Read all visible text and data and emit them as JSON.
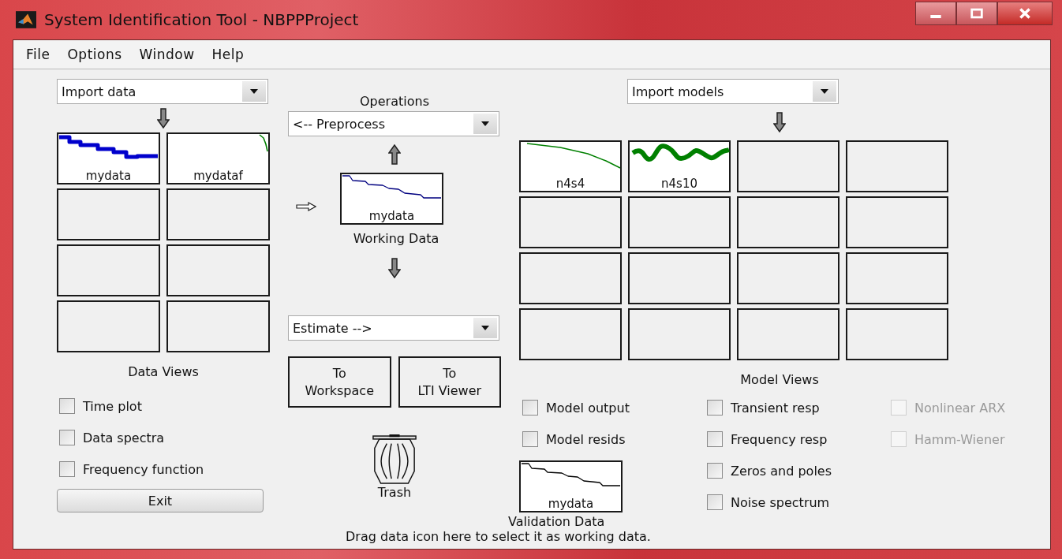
{
  "window": {
    "title": "System Identification Tool - NBPPProject"
  },
  "menu": [
    "File",
    "Options",
    "Window",
    "Help"
  ],
  "data_board": {
    "import": "Import data",
    "title": "Data Views",
    "tiles": [
      {
        "kind": "plot",
        "label": "mydata",
        "trace": {
          "kind": "step-thick",
          "color": "#0000cc"
        }
      },
      {
        "kind": "plot",
        "label": "mydataf",
        "trace": {
          "kind": "corner",
          "color": "#008000"
        }
      },
      {
        "kind": "empty"
      },
      {
        "kind": "empty"
      },
      {
        "kind": "empty"
      },
      {
        "kind": "empty"
      },
      {
        "kind": "empty"
      },
      {
        "kind": "empty"
      }
    ]
  },
  "data_views": [
    {
      "label": "Time plot",
      "checked": false
    },
    {
      "label": "Data spectra",
      "checked": false
    },
    {
      "label": "Frequency function",
      "checked": false
    }
  ],
  "exit_button": "Exit",
  "operations": {
    "title": "Operations",
    "preprocess": "<-- Preprocess",
    "working_data": {
      "label": "mydata",
      "caption": "Working Data",
      "trace": {
        "kind": "step",
        "color": "#000080"
      }
    },
    "estimate": "Estimate -->"
  },
  "export_buttons": [
    "To\nWorkspace",
    "To\nLTI Viewer"
  ],
  "trash": "Trash",
  "model_board": {
    "import": "Import models",
    "title": "Model Views",
    "tiles": [
      {
        "kind": "plot",
        "label": "n4s4",
        "trace": {
          "kind": "decay",
          "color": "#008000"
        }
      },
      {
        "kind": "plot",
        "label": "n4s10",
        "trace": {
          "kind": "wave-thick",
          "color": "#008000"
        }
      },
      {
        "kind": "empty"
      },
      {
        "kind": "empty"
      },
      {
        "kind": "empty"
      },
      {
        "kind": "empty"
      },
      {
        "kind": "empty"
      },
      {
        "kind": "empty"
      },
      {
        "kind": "empty"
      },
      {
        "kind": "empty"
      },
      {
        "kind": "empty"
      },
      {
        "kind": "empty"
      },
      {
        "kind": "empty"
      },
      {
        "kind": "empty"
      },
      {
        "kind": "empty"
      },
      {
        "kind": "empty"
      }
    ]
  },
  "model_views": [
    [
      {
        "label": "Model output",
        "checked": false,
        "disabled": false
      },
      {
        "label": "Model resids",
        "checked": false,
        "disabled": false
      }
    ],
    [
      {
        "label": "Transient resp",
        "checked": false,
        "disabled": false
      },
      {
        "label": "Frequency resp",
        "checked": false,
        "disabled": false
      },
      {
        "label": "Zeros and poles",
        "checked": false,
        "disabled": false
      },
      {
        "label": "Noise spectrum",
        "checked": false,
        "disabled": false
      }
    ],
    [
      {
        "label": "Nonlinear ARX",
        "checked": false,
        "disabled": true
      },
      {
        "label": "Hamm-Wiener",
        "checked": false,
        "disabled": true
      }
    ]
  ],
  "validation_data": {
    "label": "mydata",
    "caption": "Validation Data",
    "trace": {
      "kind": "step",
      "color": "#000000"
    }
  },
  "hint": "Drag data icon here to select it as working data."
}
